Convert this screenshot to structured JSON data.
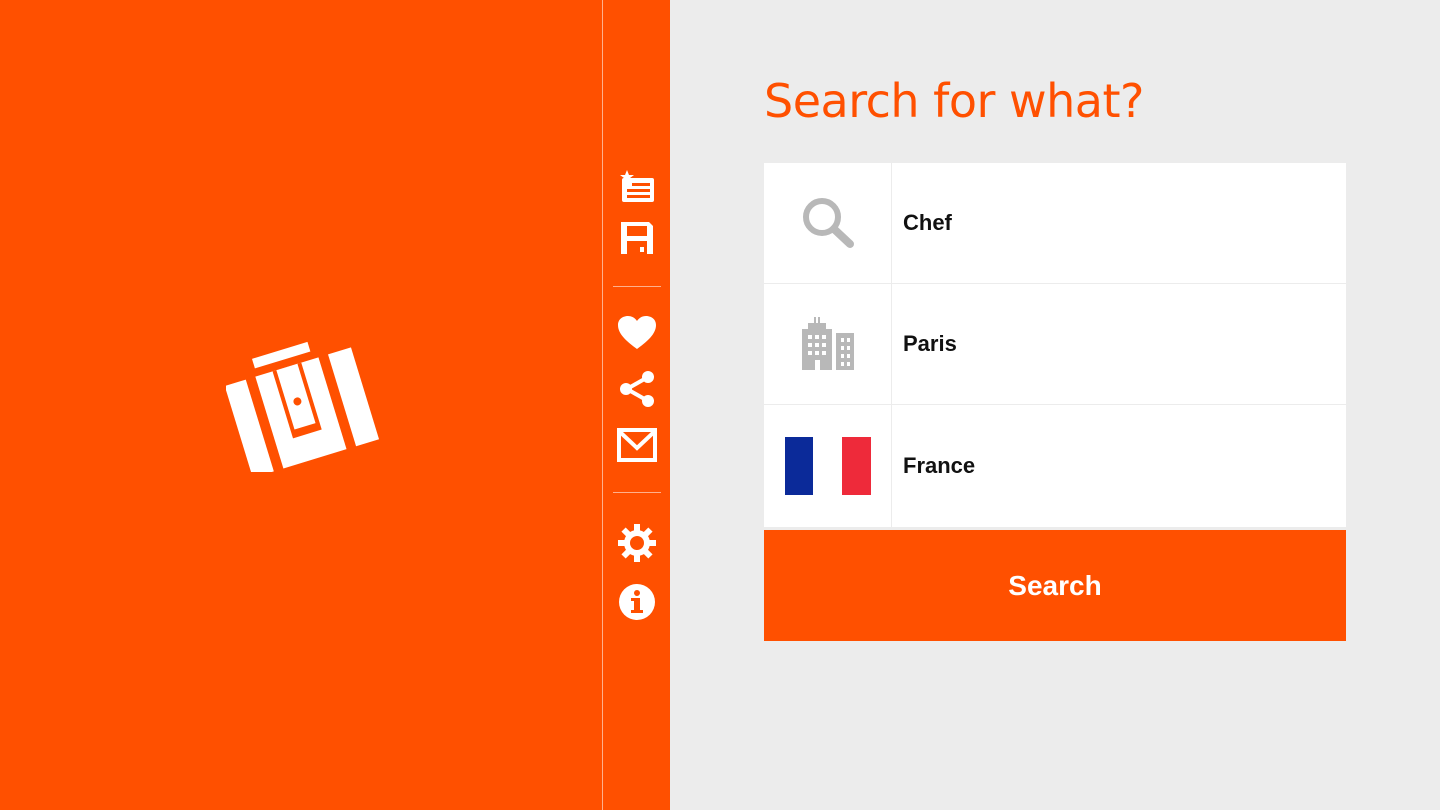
{
  "title": "Search for what?",
  "colors": {
    "accent": "#ff5000",
    "background": "#ececec",
    "icon_grey": "#b8b8b8",
    "flag_blue": "#0b2a99",
    "flag_white": "#ffffff",
    "flag_red": "#ee2a3a"
  },
  "toolbar": {
    "items": [
      {
        "name": "new-list-icon"
      },
      {
        "name": "save-icon"
      },
      {
        "name": "heart-icon"
      },
      {
        "name": "share-icon"
      },
      {
        "name": "mail-icon"
      },
      {
        "name": "settings-icon"
      },
      {
        "name": "info-icon"
      }
    ]
  },
  "form": {
    "job": {
      "value": "Chef",
      "icon": "search-icon"
    },
    "city": {
      "value": "Paris",
      "icon": "city-icon"
    },
    "country": {
      "value": "France",
      "icon": "france-flag-icon"
    }
  },
  "search_button": {
    "label": "Search"
  }
}
